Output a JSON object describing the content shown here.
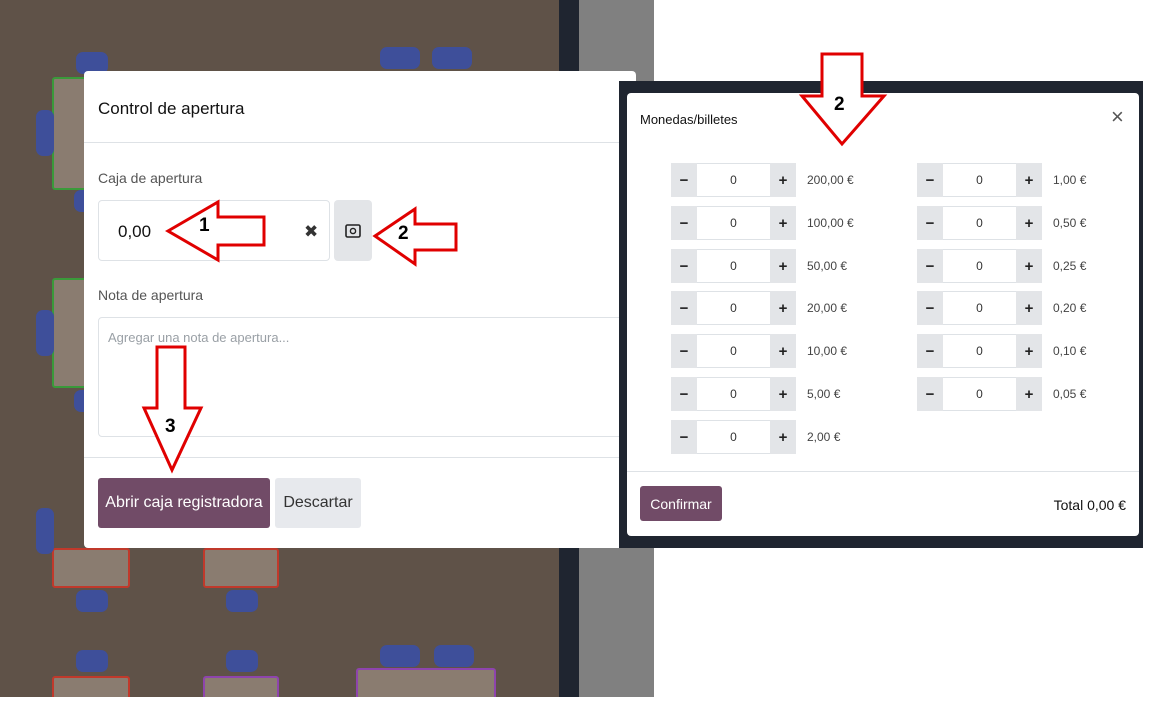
{
  "opening_dialog": {
    "title": "Control de apertura",
    "cash_label": "Caja de apertura",
    "cash_value": "0,00",
    "clear_icon": "✖",
    "note_label": "Nota de apertura",
    "note_placeholder": "Agregar una nota de apertura...",
    "open_button": "Abrir caja registradora",
    "discard_button": "Descartar"
  },
  "coins_dialog": {
    "title": "Monedas/billetes",
    "close_icon": "×",
    "left_column": [
      {
        "qty": "0",
        "denomination": "200,00 €"
      },
      {
        "qty": "0",
        "denomination": "100,00 €"
      },
      {
        "qty": "0",
        "denomination": "50,00 €"
      },
      {
        "qty": "0",
        "denomination": "20,00 €"
      },
      {
        "qty": "0",
        "denomination": "10,00 €"
      },
      {
        "qty": "0",
        "denomination": "5,00 €"
      },
      {
        "qty": "0",
        "denomination": "2,00 €"
      }
    ],
    "right_column": [
      {
        "qty": "0",
        "denomination": "1,00 €"
      },
      {
        "qty": "0",
        "denomination": "0,50 €"
      },
      {
        "qty": "0",
        "denomination": "0,25 €"
      },
      {
        "qty": "0",
        "denomination": "0,20 €"
      },
      {
        "qty": "0",
        "denomination": "0,10 €"
      },
      {
        "qty": "0",
        "denomination": "0,05 €"
      }
    ],
    "minus_symbol": "−",
    "plus_symbol": "+",
    "confirm_button": "Confirmar",
    "total_text": "Total 0,00 €"
  },
  "annotations": {
    "step1": "1",
    "step2": "2",
    "step2_top": "2",
    "step3": "3"
  },
  "colors": {
    "primary": "#714b67",
    "arrow_stroke": "#e00000"
  },
  "icons": {
    "clear": "times-icon",
    "coins": "cash-icon",
    "close": "close-icon"
  }
}
